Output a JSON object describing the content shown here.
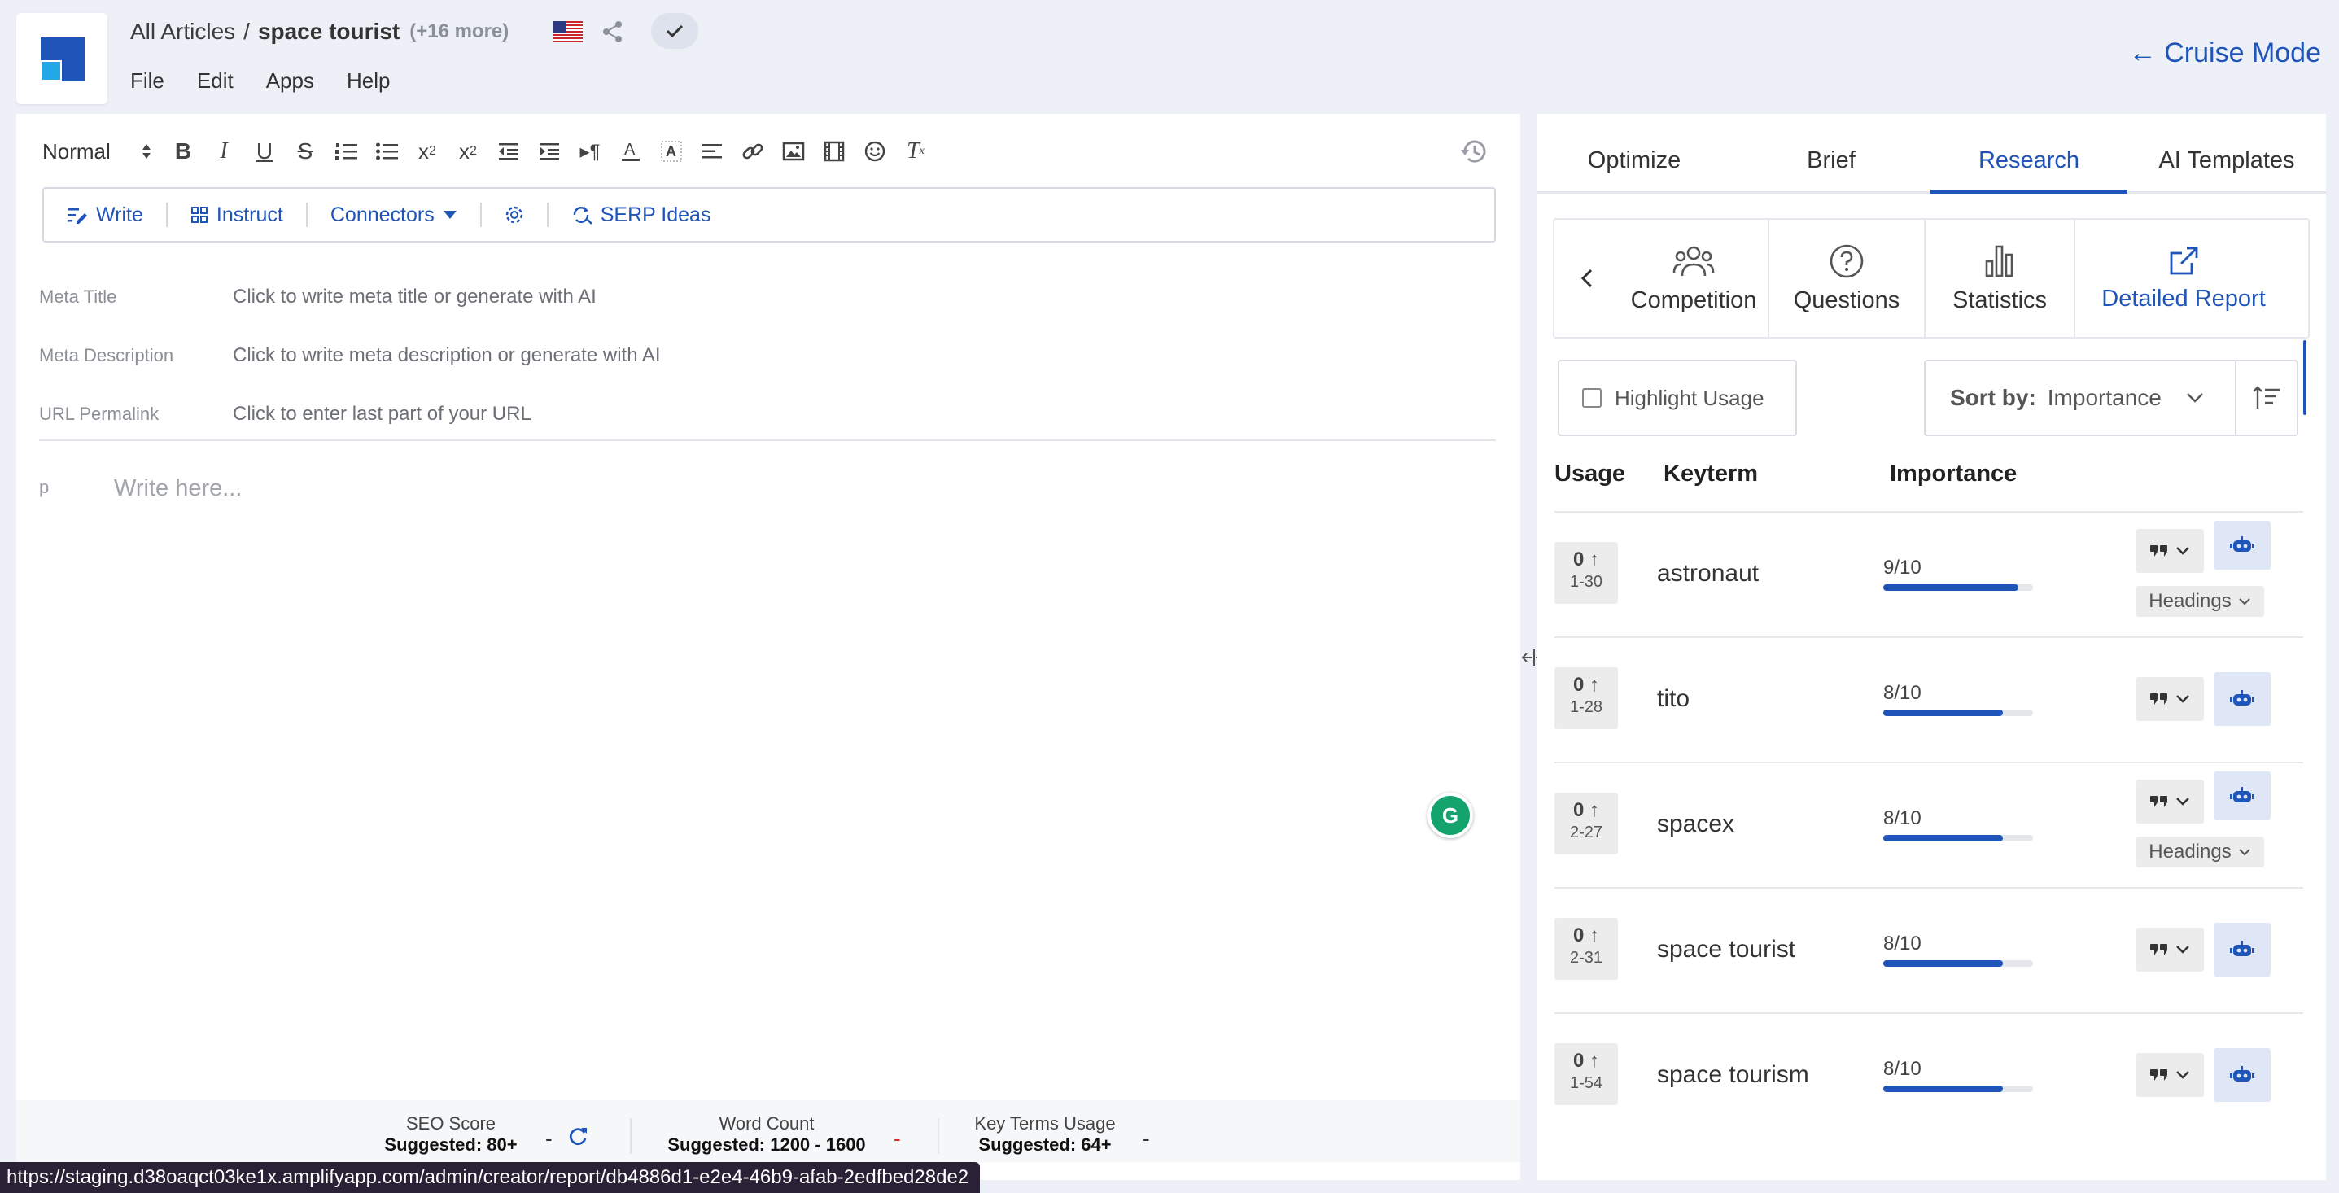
{
  "header": {
    "breadcrumb_root": "All Articles",
    "breadcrumb_sep": "/",
    "article_title": "space tourist",
    "more_count": "(+16 more)",
    "cruise_mode": "← Cruise Mode"
  },
  "menu": {
    "file": "File",
    "edit": "Edit",
    "apps": "Apps",
    "help": "Help"
  },
  "toolbar": {
    "format": "Normal"
  },
  "ai_bar": {
    "write": "Write",
    "instruct": "Instruct",
    "connectors": "Connectors",
    "serp": "SERP Ideas"
  },
  "meta": {
    "title_label": "Meta Title",
    "title_placeholder": "Click to write meta title or generate with AI",
    "desc_label": "Meta Description",
    "desc_placeholder": "Click to write meta description or generate with AI",
    "url_label": "URL Permalink",
    "url_placeholder": "Click to enter last part of your URL"
  },
  "editor": {
    "block_type": "p",
    "placeholder": "Write here..."
  },
  "grammarly": "G",
  "stats": {
    "seo_label": "SEO Score",
    "seo_suggested": "Suggested: 80+",
    "seo_value": "-",
    "wc_label": "Word Count",
    "wc_suggested": "Suggested: 1200 - 1600",
    "wc_value": "-",
    "kt_label": "Key Terms Usage",
    "kt_suggested": "Suggested: 64+",
    "kt_value": "-"
  },
  "status_url": "https://staging.d38oaqct03ke1x.amplifyapp.com/admin/creator/report/db4886d1-e2e4-46b9-afab-2edfbed28de2",
  "panel": {
    "tabs": [
      "Optimize",
      "Brief",
      "Research",
      "AI Templates"
    ],
    "active_tab": "Research",
    "subnav": {
      "competition": "Competition",
      "questions": "Questions",
      "statistics": "Statistics",
      "detailed_report": "Detailed Report"
    },
    "highlight_usage": "Highlight Usage",
    "sort_by_label": "Sort by:",
    "sort_by_value": "Importance",
    "columns": {
      "usage": "Usage",
      "keyterm": "Keyterm",
      "importance": "Importance"
    },
    "headings_label": "Headings",
    "rows": [
      {
        "usage": "0",
        "range": "1-30",
        "term": "astronaut",
        "importance": "9/10",
        "importance_value": 0.9,
        "headings": true
      },
      {
        "usage": "0",
        "range": "1-28",
        "term": "tito",
        "importance": "8/10",
        "importance_value": 0.8,
        "headings": false
      },
      {
        "usage": "0",
        "range": "2-27",
        "term": "spacex",
        "importance": "8/10",
        "importance_value": 0.8,
        "headings": true
      },
      {
        "usage": "0",
        "range": "2-31",
        "term": "space tourist",
        "importance": "8/10",
        "importance_value": 0.8,
        "headings": false
      },
      {
        "usage": "0",
        "range": "1-54",
        "term": "space tourism",
        "importance": "8/10",
        "importance_value": 0.8,
        "headings": false
      }
    ]
  },
  "colors": {
    "accent": "#1f54b8",
    "logo_dark": "#1f54b8",
    "logo_light": "#22a8e6",
    "grammarly": "#15a36d"
  }
}
